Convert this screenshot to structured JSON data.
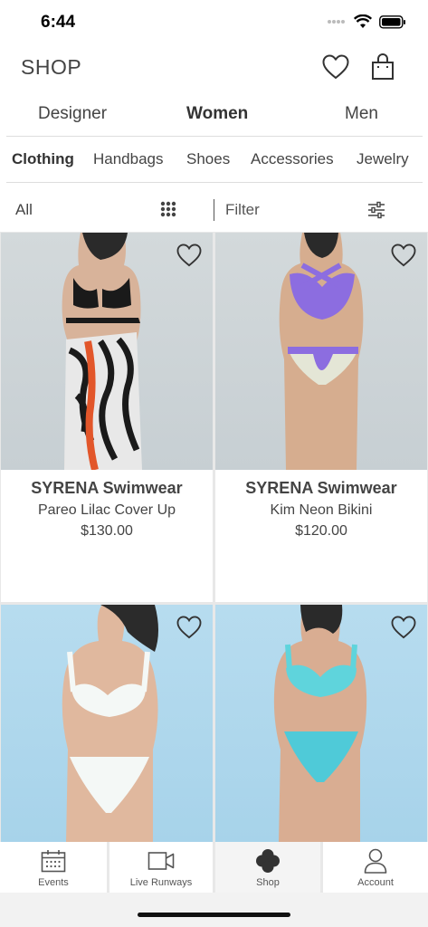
{
  "status_bar": {
    "time": "6:44"
  },
  "header": {
    "title": "SHOP"
  },
  "gender_tabs": [
    {
      "label": "Designer",
      "active": false
    },
    {
      "label": "Women",
      "active": true
    },
    {
      "label": "Men",
      "active": false
    }
  ],
  "category_tabs": [
    {
      "label": "Clothing",
      "active": true
    },
    {
      "label": "Handbags",
      "active": false
    },
    {
      "label": "Shoes",
      "active": false
    },
    {
      "label": "Accessories",
      "active": false
    },
    {
      "label": "Jewelry",
      "active": false
    }
  ],
  "filter_row": {
    "selected": "All",
    "filter_label": "Filter"
  },
  "products": [
    {
      "brand": "SYRENA Swimwear",
      "name": "Pareo Lilac Cover Up",
      "price": "$130.00"
    },
    {
      "brand": "SYRENA Swimwear",
      "name": "Kim Neon Bikini",
      "price": "$120.00"
    },
    {
      "brand": "",
      "name": "",
      "price": ""
    },
    {
      "brand": "",
      "name": "",
      "price": ""
    }
  ],
  "bottom_nav": [
    {
      "label": "Events",
      "icon": "calendar-icon",
      "active": false
    },
    {
      "label": "Live Runways",
      "icon": "video-camera-icon",
      "active": false
    },
    {
      "label": "Shop",
      "icon": "clover-icon",
      "active": true
    },
    {
      "label": "Account",
      "icon": "person-icon",
      "active": false
    }
  ],
  "colors": {
    "text": "#444444",
    "divider": "#dddddd",
    "grid_bg": "#e8e8e8"
  }
}
